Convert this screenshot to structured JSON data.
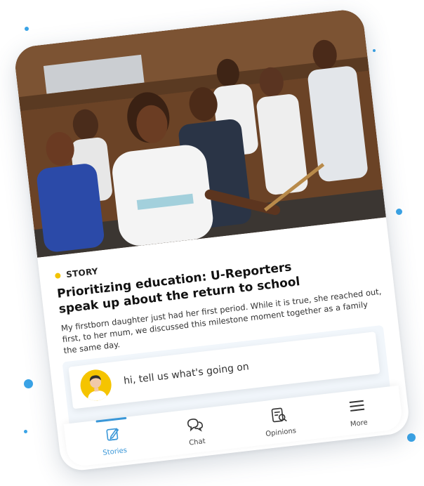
{
  "card": {
    "tag": "STORY",
    "headline": "Prioritizing education: U-Reporters speak up about the return to school",
    "excerpt": "My firstborn daughter just had her first period. While it is true, she reached out, first, to her mum, we discussed this milestone moment together as a family the same day."
  },
  "chat": {
    "prompt": "hi, tell us what's going on"
  },
  "nav": {
    "tabs": [
      {
        "label": "Stories",
        "icon": "stories-icon",
        "active": true
      },
      {
        "label": "Chat",
        "icon": "chat-icon",
        "active": false
      },
      {
        "label": "Opinions",
        "icon": "opinions-icon",
        "active": false
      },
      {
        "label": "More",
        "icon": "menu-icon",
        "active": false
      }
    ]
  },
  "colors": {
    "accent": "#3a97d8",
    "tag_dot": "#f2c300",
    "avatar_bg": "#f5c400",
    "decor_dots": "#3aa3e6"
  }
}
